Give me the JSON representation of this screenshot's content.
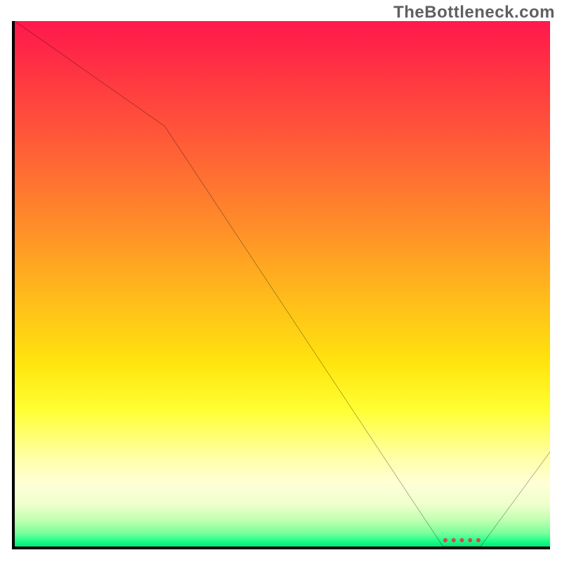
{
  "attribution": "TheBottleneck.com",
  "chart_data": {
    "type": "line",
    "title": "",
    "xlabel": "",
    "ylabel": "",
    "xlim": [
      0,
      100
    ],
    "ylim": [
      0,
      100
    ],
    "series": [
      {
        "name": "bottleneck-curve",
        "x": [
          0,
          28,
          80,
          87,
          100
        ],
        "y": [
          100,
          80,
          0,
          0,
          18
        ]
      }
    ],
    "annotations": [
      {
        "name": "optimal-range-marker",
        "x_start": 80,
        "x_end": 87,
        "y": 0
      }
    ],
    "gradient_stops": [
      {
        "pct": 0,
        "color": "#ff1a4d"
      },
      {
        "pct": 22,
        "color": "#ff5838"
      },
      {
        "pct": 52,
        "color": "#ffb91c"
      },
      {
        "pct": 74,
        "color": "#ffff33"
      },
      {
        "pct": 88,
        "color": "#ffffd6"
      },
      {
        "pct": 97.5,
        "color": "#77ff9c"
      },
      {
        "pct": 100,
        "color": "#00e878"
      }
    ]
  }
}
